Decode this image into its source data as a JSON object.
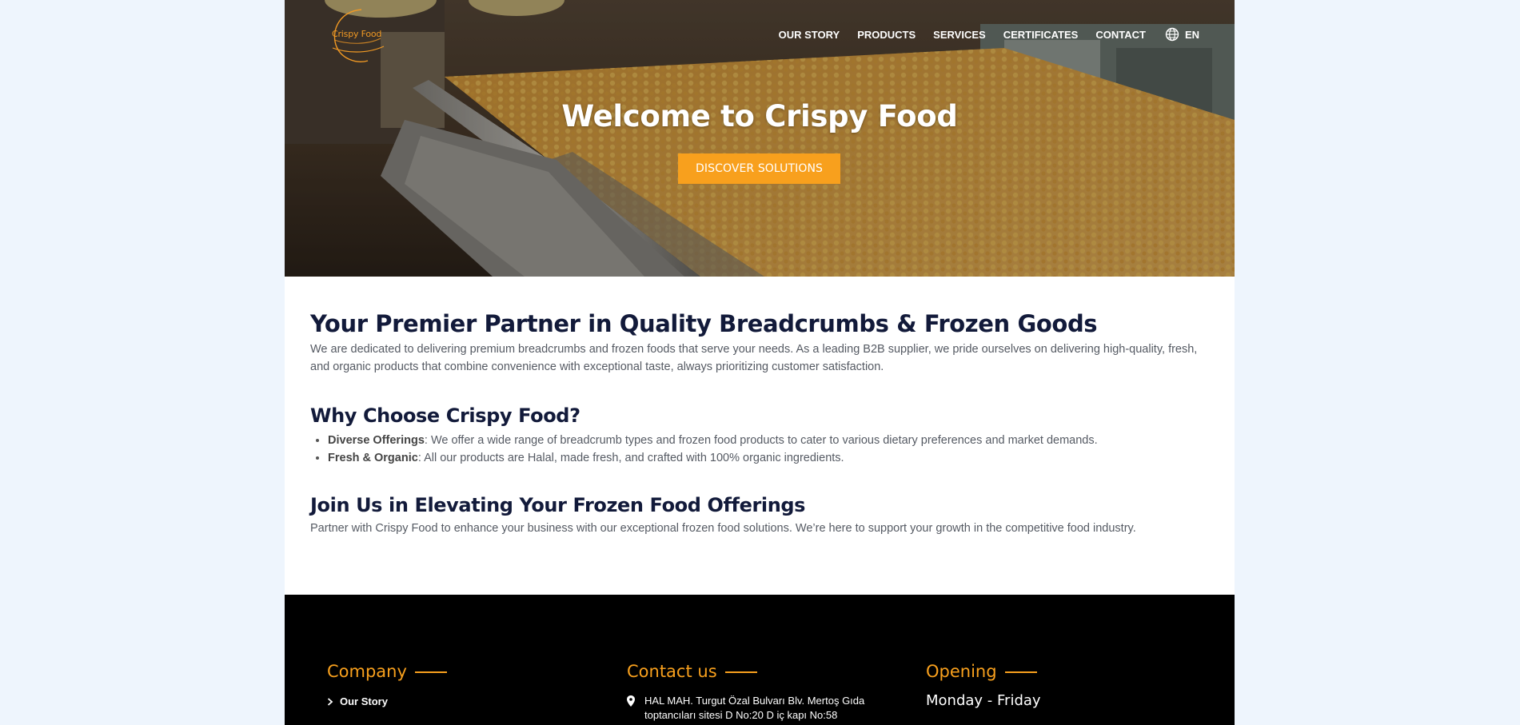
{
  "header": {
    "logo_text": "Crispy Food",
    "nav": [
      {
        "label": "OUR STORY"
      },
      {
        "label": "PRODUCTS"
      },
      {
        "label": "SERVICES"
      },
      {
        "label": "CERTIFICATES"
      },
      {
        "label": "CONTACT"
      }
    ],
    "language": "EN",
    "icons": {
      "language": "globe-icon"
    }
  },
  "hero": {
    "title": "Welcome to Crispy Food",
    "button": "DISCOVER SOLUTIONS"
  },
  "intro": {
    "heading": "Your Premier Partner in Quality Breadcrumbs & Frozen Goods",
    "text": "We are dedicated to delivering premium breadcrumbs and frozen foods that serve your needs. As a leading B2B supplier, we pride ourselves on delivering high-quality, fresh, and organic products that combine convenience with exceptional taste, always prioritizing customer satisfaction."
  },
  "why": {
    "heading": "Why Choose Crispy Food?",
    "items": [
      {
        "title": "Diverse Offerings",
        "text": ": We offer a wide range of breadcrumb types and frozen food products to cater to various dietary preferences and market demands."
      },
      {
        "title": "Fresh & Organic",
        "text": ": All our products are Halal, made fresh, and crafted with 100% organic ingredients."
      }
    ]
  },
  "join": {
    "heading": "Join Us in Elevating Your Frozen Food Offerings",
    "text": "Partner with Crispy Food to enhance your business with our exceptional frozen food solutions. We’re here to support your growth in the competitive food industry."
  },
  "footer": {
    "company": {
      "heading": "Company",
      "links": [
        "Our Story"
      ]
    },
    "contact": {
      "heading": "Contact us",
      "address": "HAL MAH. Turgut Özal Bulvarı Blv. Mertoş Gıda toptancıları sitesi D No:20 D iç kapı No:58"
    },
    "opening": {
      "heading": "Opening",
      "days": "Monday - Friday"
    }
  },
  "colors": {
    "accent": "#f8a01d",
    "heading": "#121a3a",
    "body_text": "#555a63",
    "page_bg": "#eef5fd",
    "footer_bg": "#000000"
  }
}
